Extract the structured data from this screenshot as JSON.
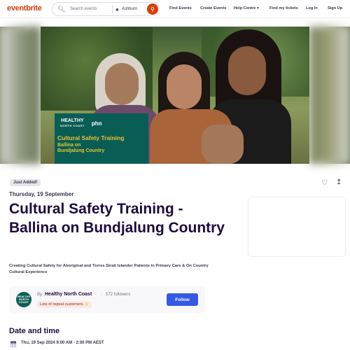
{
  "header": {
    "logo": "eventbrite",
    "search_placeholder": "Search events",
    "location": "Ashburn",
    "nav": [
      "Find Events",
      "Create Events",
      "Help Centre",
      "Find my tickets",
      "Log In",
      "Sign Up"
    ],
    "icons": {
      "search": "search-icon",
      "location": "map-pin-icon",
      "submit": "search-icon",
      "dropdown": "chevron-down-icon"
    }
  },
  "hero": {
    "banner_logo_line1": "HEALTHY",
    "banner_logo_line2": "NORTH COAST",
    "banner_phn": "phn",
    "banner_title": "Cultural Safety Training",
    "banner_sub1": "Ballina on",
    "banner_sub2": "Bundjalung Country"
  },
  "event": {
    "badge": "Just Added!",
    "date": "Thursday, 19 September",
    "title": "Cultural Safety Training - Ballina on Bundjalung Country",
    "summary": "Creating Cultural Safety for Aboriginal and Torres Strait Islander Patients in Primary Care & On Country Cultural Experience"
  },
  "organizer": {
    "by": "By",
    "name": "Healthy North Coast",
    "dot": "·",
    "followers": "572 followers",
    "pill": "Lots of repeat customers",
    "follow_label": "Follow",
    "avatar_text": "HEALTHY NORTH COAST"
  },
  "datetime": {
    "heading": "Date and time",
    "value": "Thu, 19 Sep 2024 9:00 AM - 2:00 PM AEST"
  },
  "colors": {
    "brand": "#d1410c",
    "follow": "#3659e3",
    "banner": "#0a5d54",
    "banner_text": "#e8c52b"
  }
}
